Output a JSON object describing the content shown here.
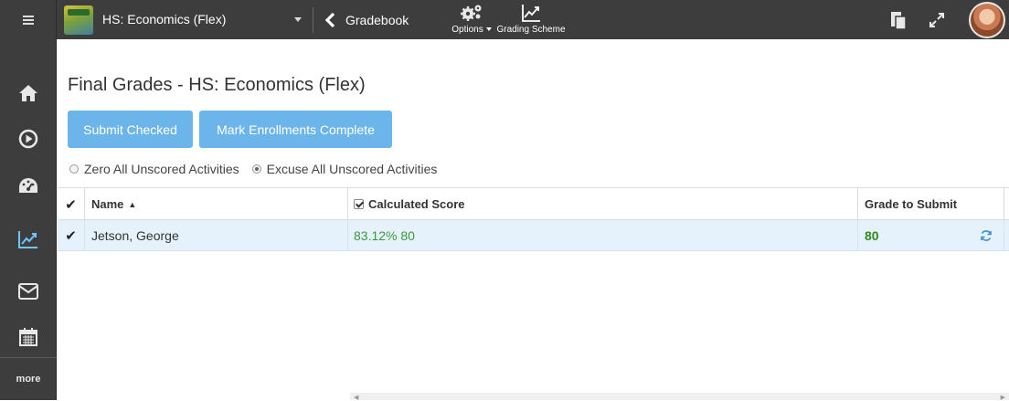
{
  "topbar": {
    "course_name": "HS: Economics (Flex)",
    "back_label": "Gradebook",
    "options_label": "Options",
    "grading_scheme_label": "Grading Scheme"
  },
  "sidebar": {
    "items": [
      {
        "icon": "home-icon"
      },
      {
        "icon": "play-circle-icon"
      },
      {
        "icon": "dashboard-icon"
      },
      {
        "icon": "chart-line-icon"
      },
      {
        "icon": "envelope-icon"
      },
      {
        "icon": "calendar-icon"
      }
    ],
    "more_label": "more"
  },
  "main": {
    "title": "Final Grades - HS: Economics (Flex)",
    "submit_checked_label": "Submit Checked",
    "mark_complete_label": "Mark Enrollments Complete",
    "radio_zero_label": "Zero All Unscored Activities",
    "radio_excuse_label": "Excuse All Unscored Activities",
    "radio_selected": "excuse"
  },
  "grid": {
    "columns": {
      "name": "Name",
      "calculated_score": "Calculated Score",
      "grade_to_submit": "Grade to Submit"
    },
    "rows": [
      {
        "checked": true,
        "name": "Jetson, George",
        "score": "83.12% 80",
        "grade": "80"
      }
    ]
  },
  "colors": {
    "topbar_bg": "#3d3d3d",
    "button_bg": "#6cb5ea",
    "row_selected_bg": "#e5f2fb",
    "score_green": "#3a9a3a"
  }
}
